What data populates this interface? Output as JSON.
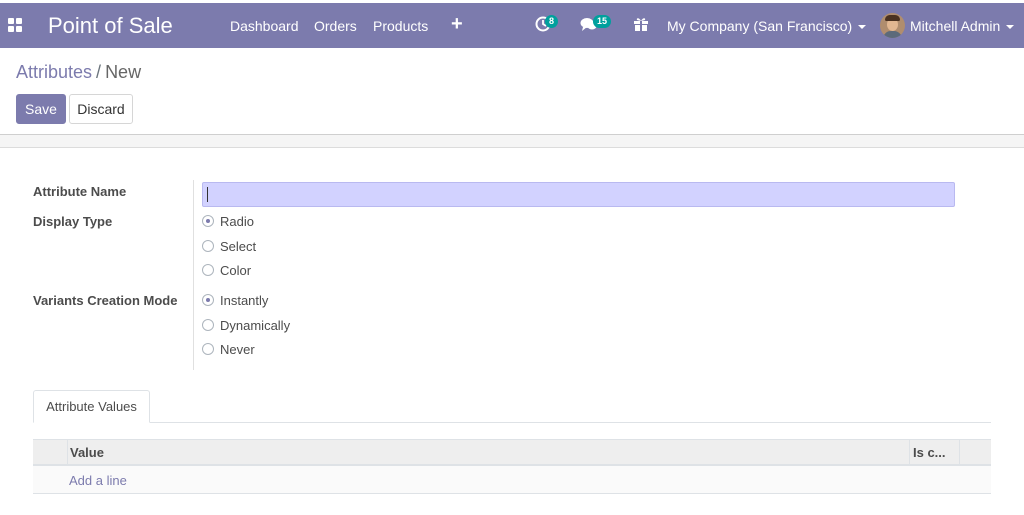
{
  "navbar": {
    "brand": "Point of Sale",
    "menu": [
      "Dashboard",
      "Orders",
      "Products"
    ],
    "activity_badge": "8",
    "messages_badge": "15",
    "company": "My Company (San Francisco)",
    "user": "Mitchell Admin",
    "bg_color": "#7c7bad",
    "badge_color": "#00a09d"
  },
  "breadcrumb": {
    "parent": "Attributes",
    "current": "New"
  },
  "buttons": {
    "save": "Save",
    "discard": "Discard"
  },
  "form": {
    "attribute_name_label": "Attribute Name",
    "attribute_name_value": "",
    "display_type_label": "Display Type",
    "display_type_options": [
      "Radio",
      "Select",
      "Color"
    ],
    "display_type_selected": "Radio",
    "variants_mode_label": "Variants Creation Mode",
    "variants_mode_options": [
      "Instantly",
      "Dynamically",
      "Never"
    ],
    "variants_mode_selected": "Instantly"
  },
  "notebook": {
    "tab_label": "Attribute Values",
    "columns": [
      "Value",
      "Is c..."
    ],
    "add_line": "Add a line"
  }
}
